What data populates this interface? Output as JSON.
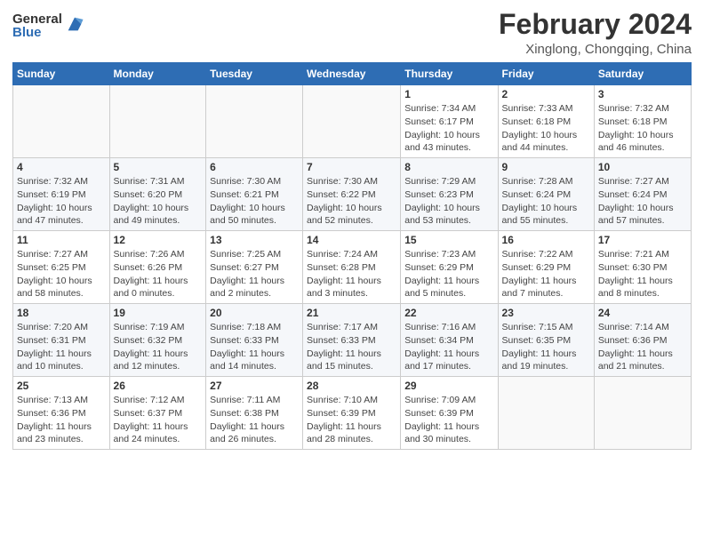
{
  "logo": {
    "general": "General",
    "blue": "Blue"
  },
  "title": "February 2024",
  "location": "Xinglong, Chongqing, China",
  "days_header": [
    "Sunday",
    "Monday",
    "Tuesday",
    "Wednesday",
    "Thursday",
    "Friday",
    "Saturday"
  ],
  "weeks": [
    [
      {
        "day": "",
        "info": ""
      },
      {
        "day": "",
        "info": ""
      },
      {
        "day": "",
        "info": ""
      },
      {
        "day": "",
        "info": ""
      },
      {
        "day": "1",
        "info": "Sunrise: 7:34 AM\nSunset: 6:17 PM\nDaylight: 10 hours and 43 minutes."
      },
      {
        "day": "2",
        "info": "Sunrise: 7:33 AM\nSunset: 6:18 PM\nDaylight: 10 hours and 44 minutes."
      },
      {
        "day": "3",
        "info": "Sunrise: 7:32 AM\nSunset: 6:18 PM\nDaylight: 10 hours and 46 minutes."
      }
    ],
    [
      {
        "day": "4",
        "info": "Sunrise: 7:32 AM\nSunset: 6:19 PM\nDaylight: 10 hours and 47 minutes."
      },
      {
        "day": "5",
        "info": "Sunrise: 7:31 AM\nSunset: 6:20 PM\nDaylight: 10 hours and 49 minutes."
      },
      {
        "day": "6",
        "info": "Sunrise: 7:30 AM\nSunset: 6:21 PM\nDaylight: 10 hours and 50 minutes."
      },
      {
        "day": "7",
        "info": "Sunrise: 7:30 AM\nSunset: 6:22 PM\nDaylight: 10 hours and 52 minutes."
      },
      {
        "day": "8",
        "info": "Sunrise: 7:29 AM\nSunset: 6:23 PM\nDaylight: 10 hours and 53 minutes."
      },
      {
        "day": "9",
        "info": "Sunrise: 7:28 AM\nSunset: 6:24 PM\nDaylight: 10 hours and 55 minutes."
      },
      {
        "day": "10",
        "info": "Sunrise: 7:27 AM\nSunset: 6:24 PM\nDaylight: 10 hours and 57 minutes."
      }
    ],
    [
      {
        "day": "11",
        "info": "Sunrise: 7:27 AM\nSunset: 6:25 PM\nDaylight: 10 hours and 58 minutes."
      },
      {
        "day": "12",
        "info": "Sunrise: 7:26 AM\nSunset: 6:26 PM\nDaylight: 11 hours and 0 minutes."
      },
      {
        "day": "13",
        "info": "Sunrise: 7:25 AM\nSunset: 6:27 PM\nDaylight: 11 hours and 2 minutes."
      },
      {
        "day": "14",
        "info": "Sunrise: 7:24 AM\nSunset: 6:28 PM\nDaylight: 11 hours and 3 minutes."
      },
      {
        "day": "15",
        "info": "Sunrise: 7:23 AM\nSunset: 6:29 PM\nDaylight: 11 hours and 5 minutes."
      },
      {
        "day": "16",
        "info": "Sunrise: 7:22 AM\nSunset: 6:29 PM\nDaylight: 11 hours and 7 minutes."
      },
      {
        "day": "17",
        "info": "Sunrise: 7:21 AM\nSunset: 6:30 PM\nDaylight: 11 hours and 8 minutes."
      }
    ],
    [
      {
        "day": "18",
        "info": "Sunrise: 7:20 AM\nSunset: 6:31 PM\nDaylight: 11 hours and 10 minutes."
      },
      {
        "day": "19",
        "info": "Sunrise: 7:19 AM\nSunset: 6:32 PM\nDaylight: 11 hours and 12 minutes."
      },
      {
        "day": "20",
        "info": "Sunrise: 7:18 AM\nSunset: 6:33 PM\nDaylight: 11 hours and 14 minutes."
      },
      {
        "day": "21",
        "info": "Sunrise: 7:17 AM\nSunset: 6:33 PM\nDaylight: 11 hours and 15 minutes."
      },
      {
        "day": "22",
        "info": "Sunrise: 7:16 AM\nSunset: 6:34 PM\nDaylight: 11 hours and 17 minutes."
      },
      {
        "day": "23",
        "info": "Sunrise: 7:15 AM\nSunset: 6:35 PM\nDaylight: 11 hours and 19 minutes."
      },
      {
        "day": "24",
        "info": "Sunrise: 7:14 AM\nSunset: 6:36 PM\nDaylight: 11 hours and 21 minutes."
      }
    ],
    [
      {
        "day": "25",
        "info": "Sunrise: 7:13 AM\nSunset: 6:36 PM\nDaylight: 11 hours and 23 minutes."
      },
      {
        "day": "26",
        "info": "Sunrise: 7:12 AM\nSunset: 6:37 PM\nDaylight: 11 hours and 24 minutes."
      },
      {
        "day": "27",
        "info": "Sunrise: 7:11 AM\nSunset: 6:38 PM\nDaylight: 11 hours and 26 minutes."
      },
      {
        "day": "28",
        "info": "Sunrise: 7:10 AM\nSunset: 6:39 PM\nDaylight: 11 hours and 28 minutes."
      },
      {
        "day": "29",
        "info": "Sunrise: 7:09 AM\nSunset: 6:39 PM\nDaylight: 11 hours and 30 minutes."
      },
      {
        "day": "",
        "info": ""
      },
      {
        "day": "",
        "info": ""
      }
    ]
  ]
}
